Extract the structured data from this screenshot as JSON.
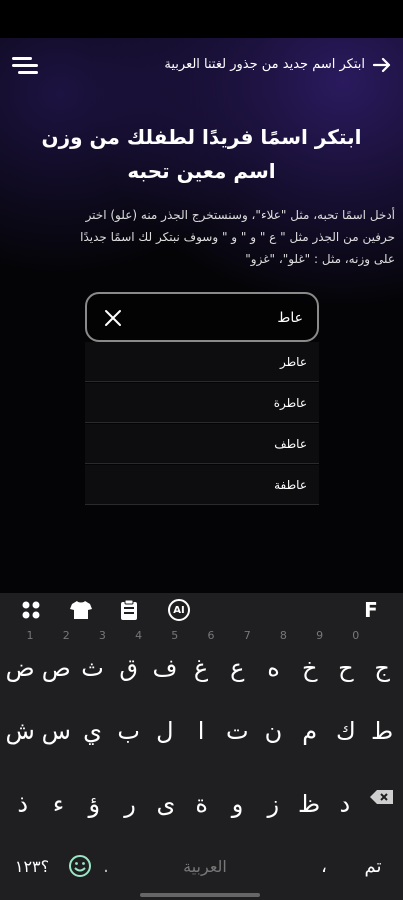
{
  "header": {
    "title": "ابتكر اسم جديد من جذور لغتنا العربية"
  },
  "headline": {
    "line1": "ابتكر اسمًا فريدًا لطفلك من وزن",
    "line2": "اسم معين تحبه"
  },
  "description": {
    "line1": "أدخل اسمًا تحبه، مثل \"علاء\"، وسنستخرج الجذر منه (علو) اختر",
    "line2": "حرفين من الجذر مثل \" ع \" و \" و \" وسوف نبتكر لك اسمًا جديدًا",
    "line3": "على وزنه، مثل : \"غلو\"، \"غزو\""
  },
  "search": {
    "value": "عاط",
    "clear_symbol": "✕"
  },
  "suggestions": [
    "عاطر",
    "عاطرة",
    "عاطف",
    "عاطفة"
  ],
  "keyboard": {
    "toolbar": {
      "ai_label": "AI",
      "f_label": "F"
    },
    "row1": {
      "keys": [
        "ج",
        "ح",
        "خ",
        "ه",
        "ع",
        "غ",
        "ف",
        "ق",
        "ث",
        "ص",
        "ض"
      ],
      "hints": [
        "",
        "",
        "",
        "",
        "",
        "",
        "",
        "",
        "",
        "",
        ""
      ]
    },
    "row2": {
      "keys": [
        "ط",
        "ك",
        "م",
        "ن",
        "ت",
        "ا",
        "ل",
        "ب",
        "ي",
        "س",
        "ش"
      ],
      "hints": [
        "",
        "",
        "",
        "",
        "",
        "",
        "",
        "",
        "",
        "",
        ""
      ]
    },
    "row3": {
      "keys": [
        "د",
        "ظ",
        "ز",
        "و",
        "ة",
        "ى",
        "ر",
        "ؤ",
        "ء",
        "ذ"
      ]
    },
    "row1_numbers": [
      "1",
      "2",
      "3",
      "4",
      "5",
      "6",
      "7",
      "8",
      "9",
      "0"
    ],
    "bottom": {
      "done_label": "تم",
      "comma": "،",
      "space_label": "العربية",
      "period": ".",
      "numbers_label": "؟١٢٣"
    }
  }
}
